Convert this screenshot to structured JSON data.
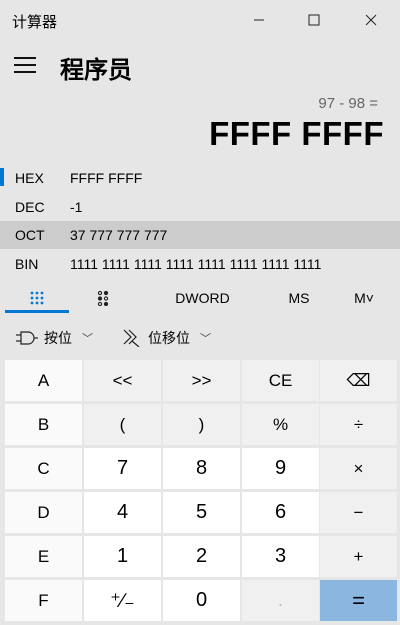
{
  "window": {
    "title": "计算器",
    "minimize_icon": "minimize-icon",
    "maximize_icon": "maximize-icon",
    "close_icon": "close-icon"
  },
  "header": {
    "mode": "程序员"
  },
  "display": {
    "expression": "97 - 98 =",
    "result": "FFFF FFFF"
  },
  "radix": [
    {
      "label": "HEX",
      "value": "FFFF FFFF",
      "selected": true
    },
    {
      "label": "DEC",
      "value": "-1"
    },
    {
      "label": "OCT",
      "value": "37 777 777 777",
      "highlighted": true
    },
    {
      "label": "BIN",
      "value": "1111 1111 1111 1111 1111 1111 1111 1111"
    }
  ],
  "tabs": {
    "full_keypad_icon": "keypad-grid-icon",
    "bit_toggle_icon": "bit-toggle-icon",
    "word_size": "DWORD",
    "ms": "MS",
    "m_dropdown": "M˅"
  },
  "dropdowns": {
    "bitwise": "按位",
    "bitshift": "位移位"
  },
  "keys": [
    [
      "A",
      "<<",
      ">>",
      "CE",
      "⌫"
    ],
    [
      "B",
      "(",
      ")",
      "%",
      "÷"
    ],
    [
      "C",
      "7",
      "8",
      "9",
      "×"
    ],
    [
      "D",
      "4",
      "5",
      "6",
      "−"
    ],
    [
      "E",
      "1",
      "2",
      "3",
      "+"
    ],
    [
      "F",
      "⁺∕₋",
      "0",
      ".",
      "="
    ]
  ],
  "colors": {
    "accent": "#0078d4",
    "equals": "#8ab6e0",
    "background": "#e6e6e6"
  }
}
